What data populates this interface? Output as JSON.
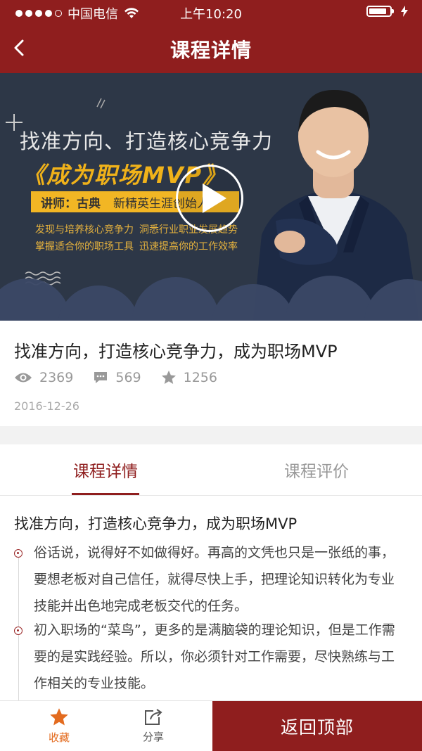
{
  "status_bar": {
    "carrier": "中国电信",
    "time": "上午10:20"
  },
  "nav": {
    "title": "课程详情",
    "back_icon": "chevron-left-icon"
  },
  "hero": {
    "line1": "找准方向、打造核心竞争力",
    "line2": "《成为职场MVP》",
    "lecturer_label": "讲师：古典",
    "lecturer_title": "新精英生涯创始人",
    "feature1": "发现与培养核心竞争力",
    "feature2": "洞悉行业职业发展趋势",
    "feature3": "掌握适合你的职场工具",
    "feature4": "迅速提高你的工作效率",
    "play_icon": "play-icon"
  },
  "course": {
    "title": "找准方向，打造核心竞争力，成为职场MVP",
    "views": "2369",
    "comments": "569",
    "stars": "1256",
    "date": "2016-12-26"
  },
  "tabs": [
    {
      "label": "课程详情",
      "active": true
    },
    {
      "label": "课程评价",
      "active": false
    }
  ],
  "detail": {
    "heading": "找准方向，打造核心竞争力，成为职场MVP",
    "paragraphs": [
      "俗话说，说得好不如做得好。再高的文凭也只是一张纸的事，要想老板对自己信任，就得尽快上手，把理论知识转化为专业技能并出色地完成老板交代的任务。",
      "初入职场的“菜鸟”，更多的是满脑袋的理论知识，但是工作需要的是实践经验。所以，你必须针对工作需要，尽快熟练与工作相关的专业技能。"
    ]
  },
  "bottom_bar": {
    "favorite": "收藏",
    "share": "分享",
    "back_to_top": "返回顶部"
  },
  "colors": {
    "primary": "#8f1e1e",
    "accent_orange": "#e36b1f",
    "hero_bg": "#2d3747",
    "hero_yellow": "#f2b624"
  }
}
